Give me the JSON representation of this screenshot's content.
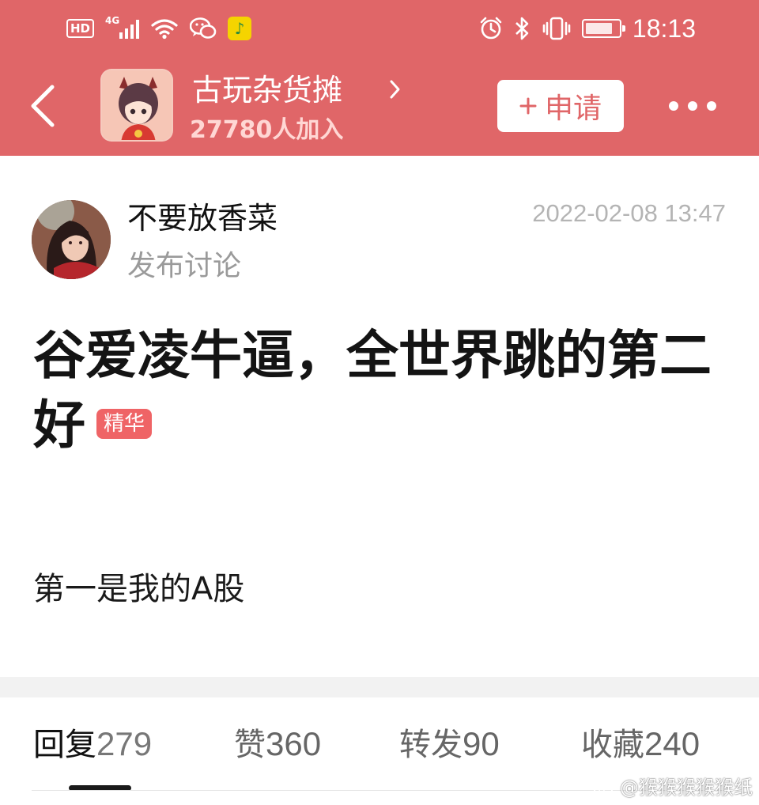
{
  "status_bar": {
    "hd": "HD",
    "network": "4G",
    "time": "18:13",
    "icons": [
      "signal-icon",
      "wifi-icon",
      "wechat-icon",
      "qq-music-icon",
      "alarm-icon",
      "bluetooth-icon",
      "vibrate-icon",
      "battery-icon"
    ]
  },
  "header": {
    "group_name": "古玩杂货摊",
    "member_count": "27780人加入",
    "apply_label": "申请",
    "background_color": "#e06668"
  },
  "post": {
    "author": "不要放香菜",
    "action": "发布讨论",
    "timestamp": "2022-02-08 13:47",
    "title": "谷爱凌牛逼，全世界跳的第二好",
    "badge": "精华",
    "body": "第一是我的A股"
  },
  "stats": {
    "reply_label": "回复",
    "reply_count": "279",
    "like_label": "赞",
    "like_count": "360",
    "repost_label": "转发",
    "repost_count": "90",
    "collect_label": "收藏",
    "collect_count": "240",
    "active_tab": "回复"
  },
  "watermark": "@猴猴猴猴猴纸"
}
